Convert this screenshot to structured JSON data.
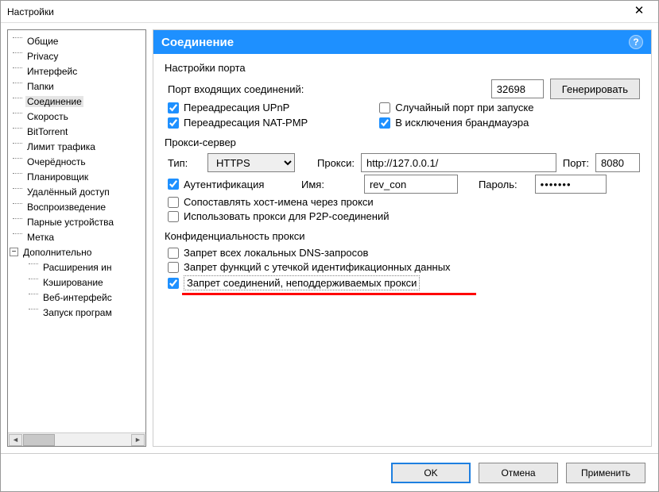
{
  "window": {
    "title": "Настройки"
  },
  "tree": {
    "items": [
      {
        "label": "Общие"
      },
      {
        "label": "Privacy"
      },
      {
        "label": "Интерфейс"
      },
      {
        "label": "Папки"
      },
      {
        "label": "Соединение",
        "selected": true
      },
      {
        "label": "Скорость"
      },
      {
        "label": "BitTorrent"
      },
      {
        "label": "Лимит трафика"
      },
      {
        "label": "Очерёдность"
      },
      {
        "label": "Планировщик"
      },
      {
        "label": "Удалённый доступ"
      },
      {
        "label": "Воспроизведение"
      },
      {
        "label": "Парные устройства"
      },
      {
        "label": "Метка"
      }
    ],
    "advanced_label": "Дополнительно",
    "advanced_items": [
      {
        "label": "Расширения ин"
      },
      {
        "label": "Кэширование"
      },
      {
        "label": "Веб-интерфейс"
      },
      {
        "label": "Запуск програм"
      }
    ]
  },
  "panel": {
    "title": "Соединение",
    "port_group": {
      "legend": "Настройки порта",
      "incoming_label": "Порт входящих соединений:",
      "port_value": "32698",
      "generate_btn": "Генерировать",
      "upnp": "Переадресация UPnP",
      "natpmp": "Переадресация NAT-PMP",
      "random": "Случайный порт при запуске",
      "firewall": "В исключения брандмауэра"
    },
    "proxy_group": {
      "legend": "Прокси-сервер",
      "type_label": "Тип:",
      "type_value": "HTTPS",
      "proxy_label": "Прокси:",
      "proxy_value": "http://127.0.0.1/",
      "port_label": "Порт:",
      "port_value": "8080",
      "auth": "Аутентификация",
      "user_label": "Имя:",
      "user_value": "rev_con",
      "pass_label": "Пароль:",
      "pass_value": "•••••••",
      "resolve": "Сопоставлять хост-имена через прокси",
      "p2p": "Использовать прокси для P2P-соединений"
    },
    "privacy_group": {
      "legend": "Конфиденциальность прокси",
      "dns": "Запрет всех локальных DNS-запросов",
      "leak": "Запрет функций с утечкой идентификационных данных",
      "noproxy": "Запрет соединений, неподдерживаемых прокси"
    }
  },
  "footer": {
    "ok": "OK",
    "cancel": "Отмена",
    "apply": "Применить"
  }
}
